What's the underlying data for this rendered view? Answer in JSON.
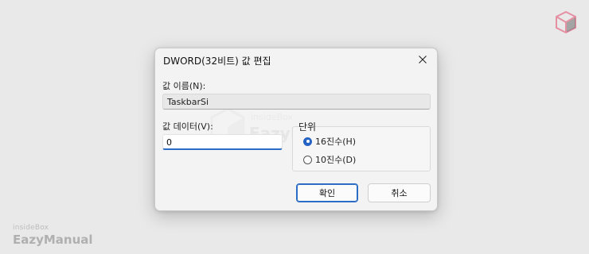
{
  "dialog": {
    "title": "DWORD(32비트) 값 편집",
    "value_name_label": "값 이름(N):",
    "value_name": "TaskbarSi",
    "value_data_label": "값 데이터(V):",
    "value_data": "0",
    "base_label": "단위",
    "base_options": [
      {
        "label": "16진수(H)",
        "selected": true
      },
      {
        "label": "10진수(D)",
        "selected": false
      }
    ],
    "ok_label": "확인",
    "cancel_label": "취소"
  },
  "watermark": {
    "small": "insideBox",
    "big": "EazyManual"
  },
  "corner_brand": {
    "small": "insideBox",
    "big": "EazyManual"
  },
  "colors": {
    "accent": "#2462c4",
    "cube": "#e58fa3"
  },
  "icons": {
    "close": "close-icon",
    "brand": "cube-logo-icon"
  }
}
